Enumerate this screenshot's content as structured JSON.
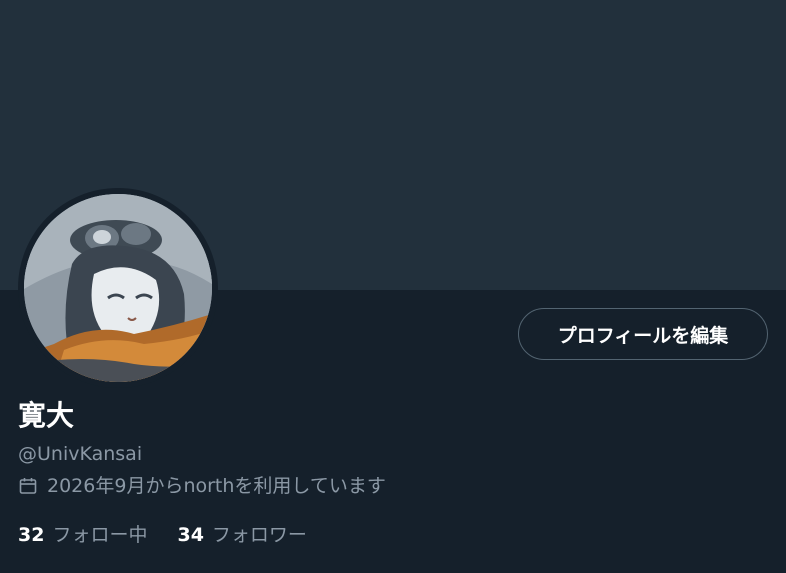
{
  "profile": {
    "display_name": "寛大",
    "handle": "@UnivKansai",
    "joined": "2026年9月からnorthを利用しています",
    "edit_button_label": "プロフィールを編集"
  },
  "stats": {
    "following_count": "32",
    "following_label": "フォロー中",
    "followers_count": "34",
    "followers_label": "フォロワー"
  },
  "icons": {
    "calendar": "calendar-icon"
  },
  "colors": {
    "background": "#15202b",
    "banner": "#22303c",
    "secondary_text": "#8b98a5",
    "button_border": "#536471"
  }
}
